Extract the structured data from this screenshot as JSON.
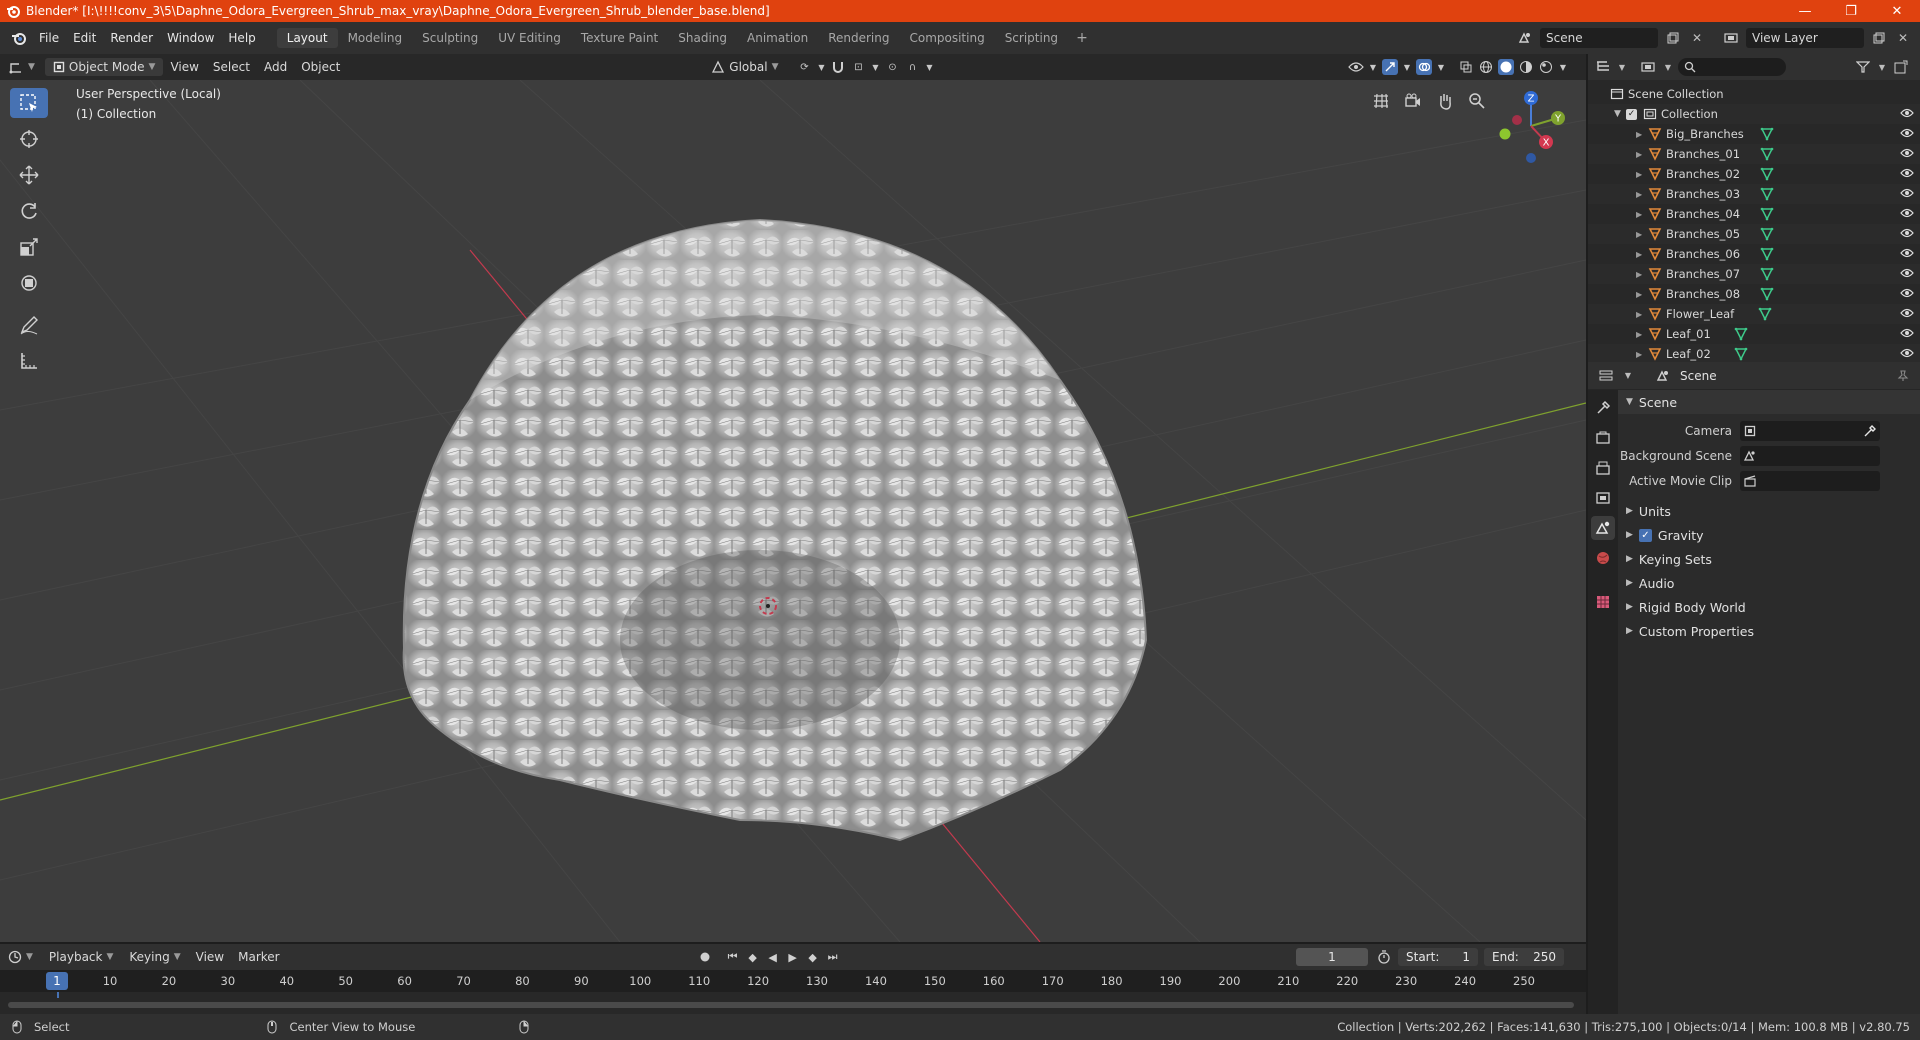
{
  "window": {
    "title": "Blender* [I:\\!!!!conv_3\\5\\Daphne_Odora_Evergreen_Shrub_max_vray\\Daphne_Odora_Evergreen_Shrub_blender_base.blend]",
    "minimize": "—",
    "restore": "❐",
    "close": "✕"
  },
  "menu": {
    "items": [
      "File",
      "Edit",
      "Render",
      "Window",
      "Help"
    ]
  },
  "workspaces": {
    "tabs": [
      "Layout",
      "Modeling",
      "Sculpting",
      "UV Editing",
      "Texture Paint",
      "Shading",
      "Animation",
      "Rendering",
      "Compositing",
      "Scripting"
    ],
    "active": "Layout",
    "add": "+"
  },
  "scene_selector": {
    "label": "Scene"
  },
  "view_layer": {
    "label": "View Layer"
  },
  "viewport_header": {
    "mode": "Object Mode",
    "menus": [
      "View",
      "Select",
      "Add",
      "Object"
    ],
    "transform_orientation": "Global"
  },
  "viewport": {
    "perspective": "User Perspective (Local)",
    "collection": "(1) Collection",
    "gizmo": {
      "z": "Z",
      "y": "Y",
      "x": "X"
    }
  },
  "outliner": {
    "root": "Scene Collection",
    "collection": "Collection",
    "objects": [
      "Big_Branches",
      "Branches_01",
      "Branches_02",
      "Branches_03",
      "Branches_04",
      "Branches_05",
      "Branches_06",
      "Branches_07",
      "Branches_08",
      "Flower_Leaf",
      "Leaf_01",
      "Leaf_02"
    ]
  },
  "properties": {
    "context": "Scene",
    "panel": "Scene",
    "fields": {
      "camera": "Camera",
      "background_scene": "Background Scene",
      "active_movie_clip": "Active Movie Clip"
    },
    "sections": [
      "Units",
      "Gravity",
      "Keying Sets",
      "Audio",
      "Rigid Body World",
      "Custom Properties"
    ]
  },
  "timeline": {
    "menus": [
      "Playback",
      "Keying",
      "View",
      "Marker"
    ],
    "current_frame": "1",
    "start_label": "Start:",
    "start": "1",
    "end_label": "End:",
    "end": "250",
    "ticks": [
      "10",
      "20",
      "30",
      "40",
      "50",
      "60",
      "70",
      "80",
      "90",
      "100",
      "110",
      "120",
      "130",
      "140",
      "150",
      "160",
      "170",
      "180",
      "190",
      "200",
      "210",
      "220",
      "230",
      "240",
      "250"
    ]
  },
  "status": {
    "select": "Select",
    "center_view": "Center View to Mouse",
    "stats": "Collection | Verts:202,262 | Faces:141,630 | Tris:275,100 | Objects:0/14 | Mem: 100.8 MB | v2.80.75"
  },
  "colors": {
    "title_bar": "#e0420f",
    "accent": "#4772b3",
    "mesh_orange": "#e2893a",
    "mesh_data_green": "#3ec98a",
    "axis_x": "#c33a4e",
    "axis_y": "#7fa22e"
  }
}
